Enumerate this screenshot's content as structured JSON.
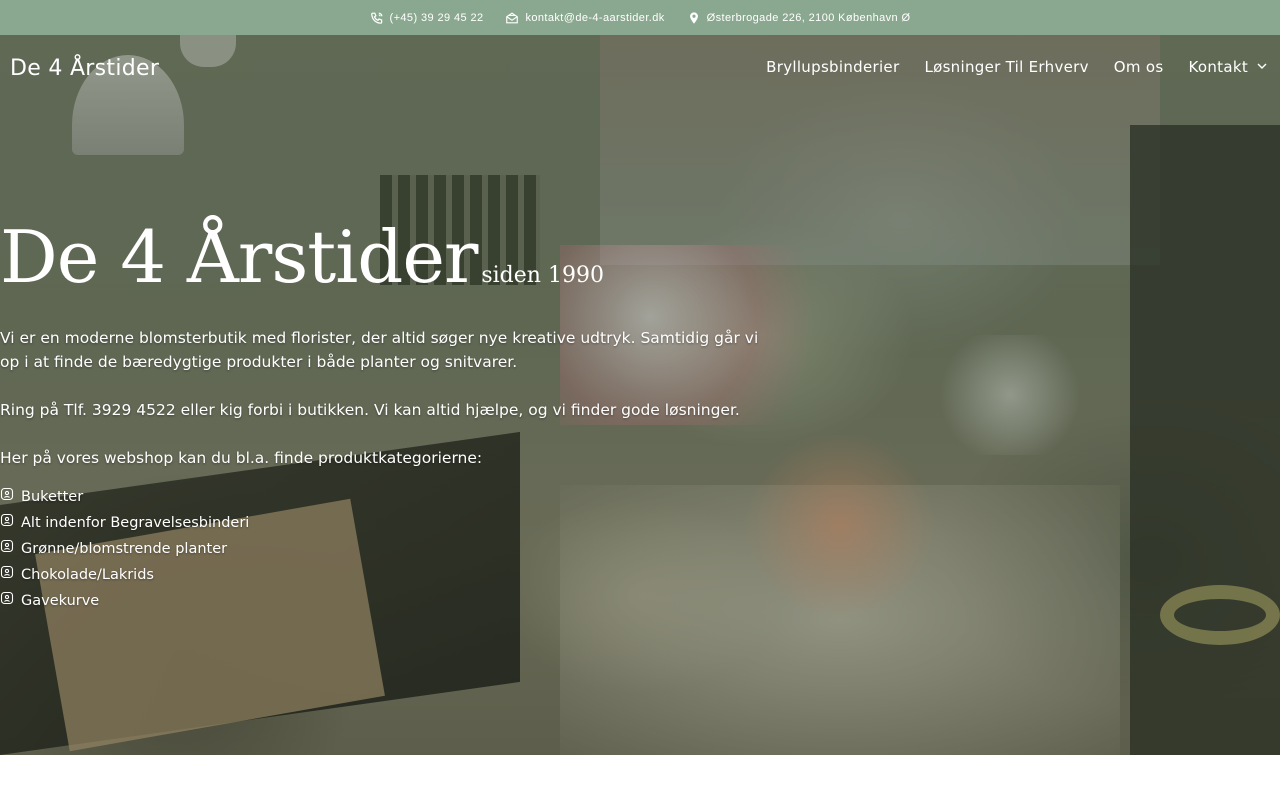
{
  "topbar": {
    "phone": "(+45) 39 29 45 22",
    "email": "kontakt@de-4-aarstider.dk",
    "address": "Østerbrogade 226, 2100 København Ø"
  },
  "header": {
    "brand": "De 4 Årstider",
    "nav": [
      {
        "label": "Bryllupsbinderier"
      },
      {
        "label": "Løsninger Til Erhverv"
      },
      {
        "label": "Om os"
      },
      {
        "label": "Kontakt"
      }
    ]
  },
  "hero": {
    "title": "De 4 Årstider",
    "subtitle": "siden 1990",
    "paragraph1": "Vi er en moderne blomsterbutik med florister, der altid søger nye kreative udtryk. Samtidig går vi op i at finde de bæredygtige produkter i både planter og snitvarer.",
    "paragraph2": "Ring på Tlf. 3929 4522 eller kig forbi i butikken. Vi kan altid hjælpe, og vi finder gode løsninger.",
    "paragraph3": "Her på vores webshop kan du bl.a. finde produktkategorierne:",
    "categories": [
      {
        "label": "Buketter"
      },
      {
        "label": "Alt indenfor Begravelsesbinderi"
      },
      {
        "label": "Grønne/blomstrende planter"
      },
      {
        "label": "Chokolade/Lakrids"
      },
      {
        "label": "Gavekurve"
      }
    ]
  },
  "colors": {
    "topbar_bg": "#8aa88f",
    "text": "#ffffff"
  },
  "icons": {
    "phone": "phone-icon",
    "email": "envelope-icon",
    "address": "map-pin-icon",
    "dropdown": "chevron-down-icon",
    "list_bullet": "flower-badge-icon"
  }
}
